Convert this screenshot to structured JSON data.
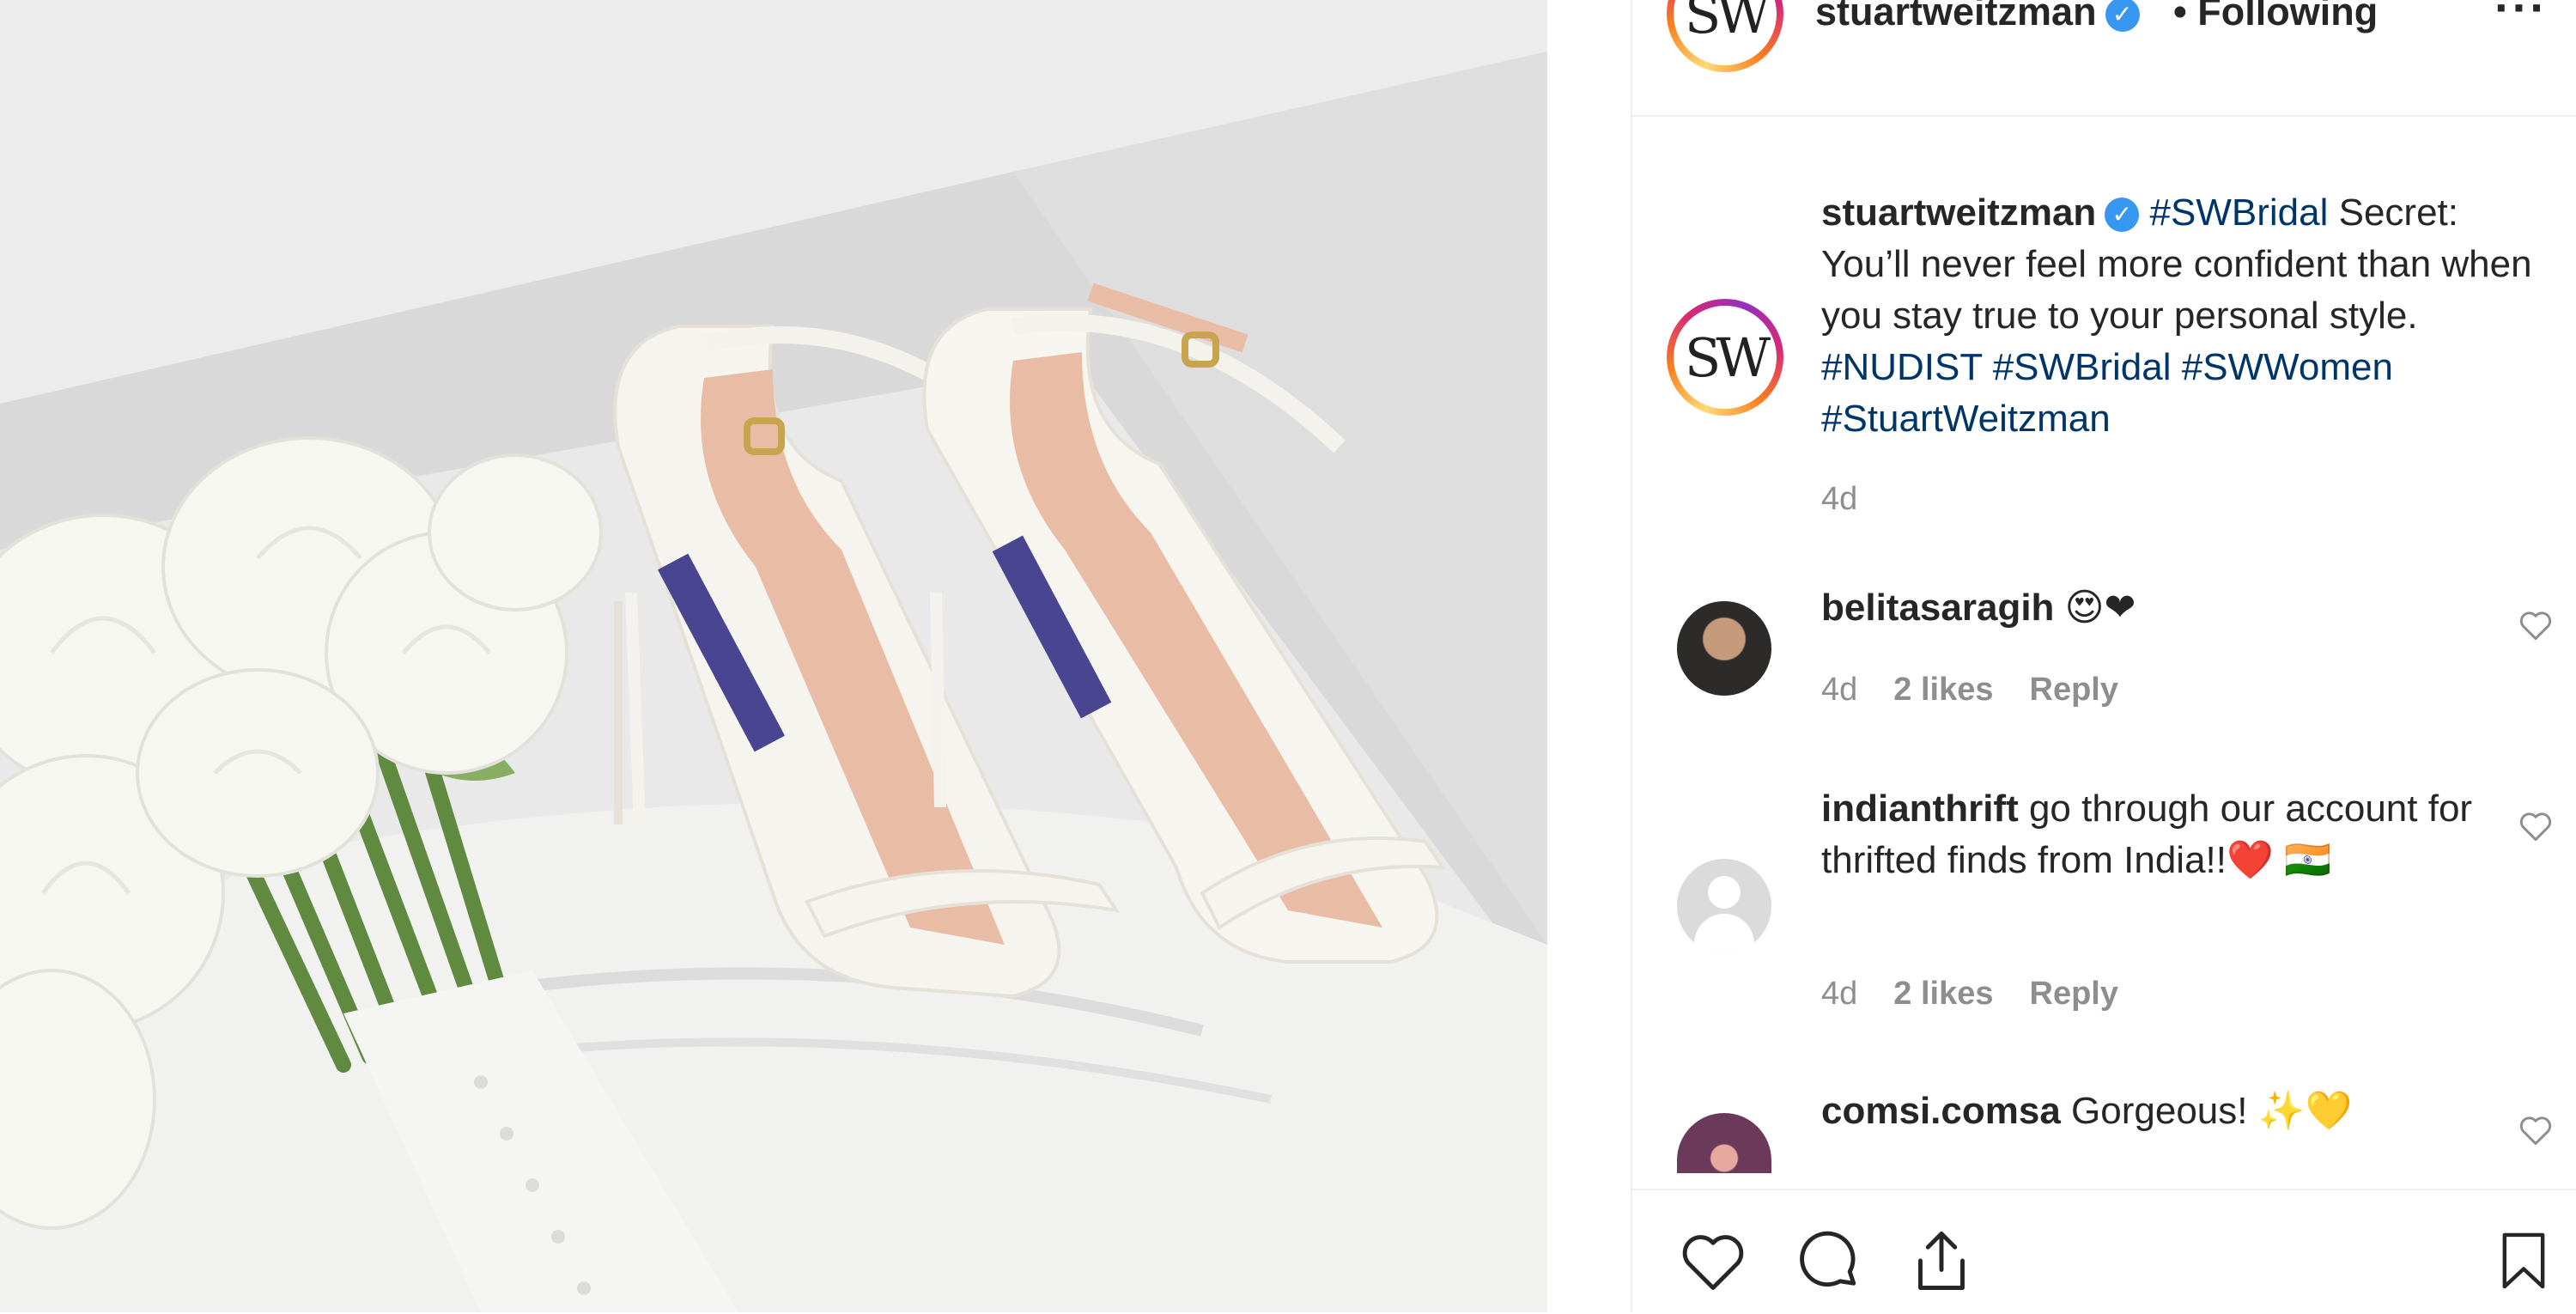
{
  "post": {
    "username": "stuartweitzman",
    "verified": true,
    "follow_status": "• Following",
    "more": "···",
    "avatar_text": "SW",
    "caption_username": "stuartweitzman",
    "caption_parts": {
      "tag1": "#SWBridal",
      "text": " Secret: You’ll never feel more confident than when you stay true to your personal style. ",
      "tag2": "#NUDIST",
      "tag3": "#SWBridal",
      "tag4": "#SWWomen",
      "tag5": "#StuartWeitzman"
    },
    "caption_time": "4d"
  },
  "comments": [
    {
      "username": "belitasaragih",
      "text": " 😍❤",
      "time": "4d",
      "likes": "2 likes",
      "reply": "Reply"
    },
    {
      "username": "indianthrift",
      "text": " go through our account for thrifted finds from India!!❤️ 🇮🇳",
      "time": "4d",
      "likes": "2 likes",
      "reply": "Reply"
    },
    {
      "username": "comsi.comsa",
      "text": " Gorgeous! ✨💛"
    }
  ],
  "icons": {
    "like": "heart-icon",
    "comment": "comment-bubble-icon",
    "share": "share-icon",
    "save": "bookmark-icon"
  },
  "colors": {
    "hashtag": "#003569",
    "verified": "#3897f0",
    "muted": "#8e8e8e"
  }
}
